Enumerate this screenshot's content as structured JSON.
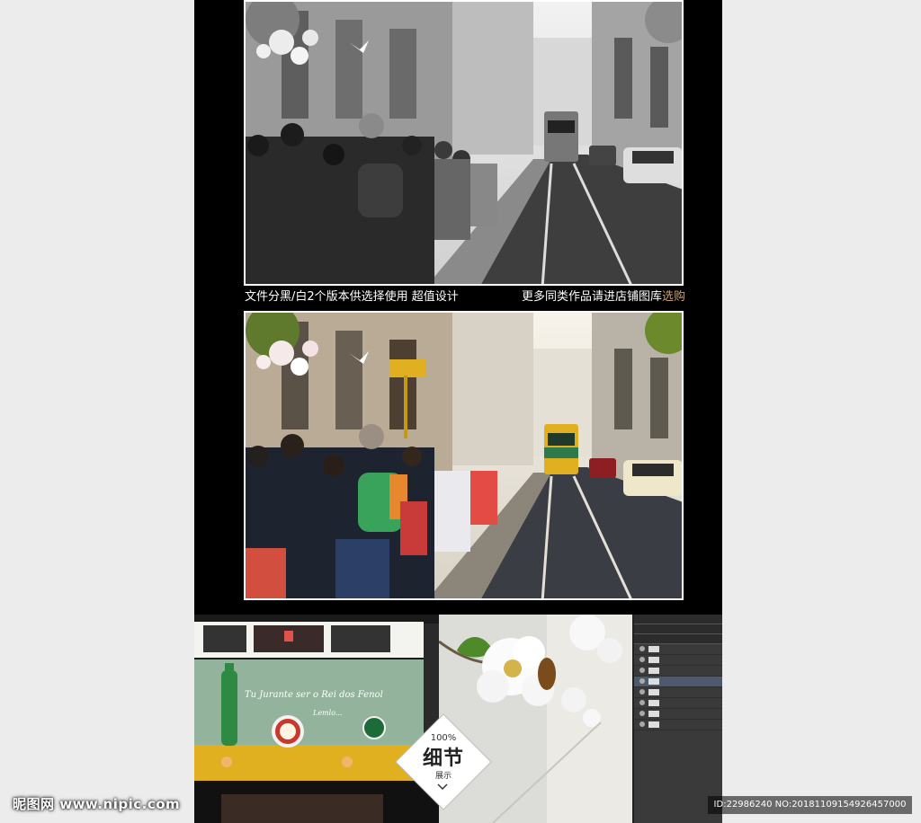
{
  "caption": {
    "left": "文件分黑/白2个版本供选择使用  超值设计",
    "right_prefix": "更多同类作品请进店铺图库",
    "right_accent": "选购"
  },
  "detail_badge": {
    "percent": "100%",
    "title": "细节",
    "subtitle": "展示"
  },
  "tram_text": {
    "script": "Tu Jurante ser o Rei dos Fenol",
    "sub": "Lemlo..."
  },
  "watermark": {
    "site": "昵图网 www.nipic.com",
    "id": "ID:22986240 NO:20181109154926457000"
  },
  "colors": {
    "poster_bg": "#000000",
    "page_bg": "#ececec",
    "accent": "#c9a27a",
    "tram_yellow": "#e0b021",
    "tram_green": "#2f7a4a"
  }
}
